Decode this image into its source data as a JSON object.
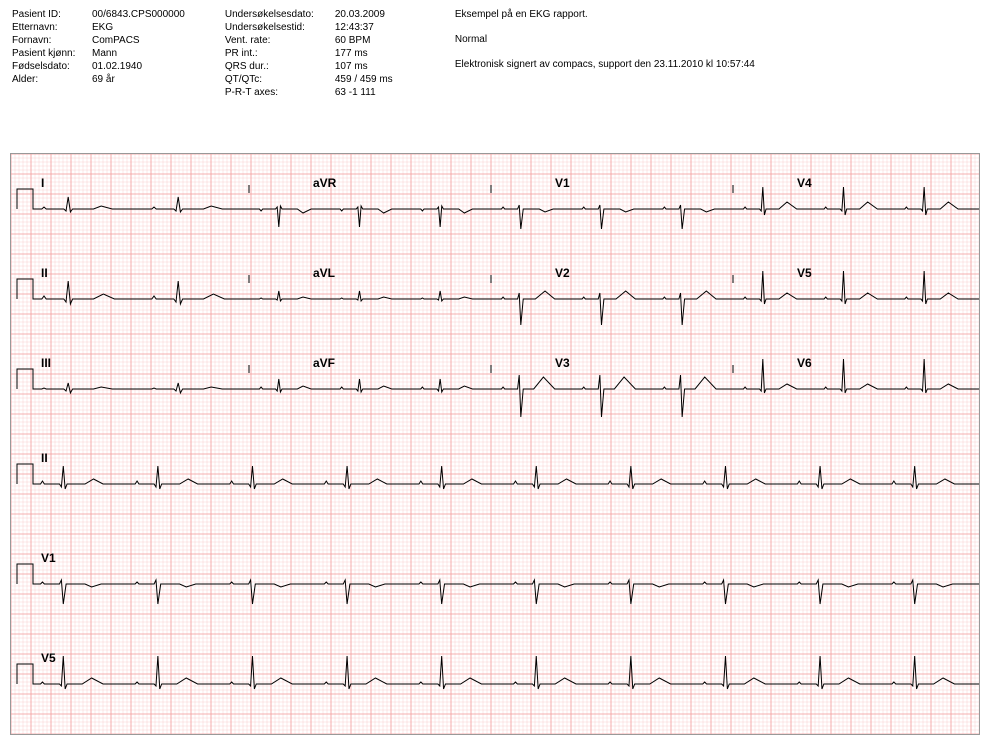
{
  "header": {
    "col1": {
      "labels": [
        "Pasient ID:",
        "Etternavn:",
        "Fornavn:",
        "Pasient kjønn:",
        "Fødselsdato:",
        "Alder:"
      ],
      "values": [
        "00/6843.CPS000000",
        "EKG",
        "ComPACS",
        "Mann",
        "01.02.1940",
        "69 år"
      ]
    },
    "col2": {
      "labels": [
        "Undersøkelsesdato:",
        "Undersøkelsestid:",
        "Vent. rate:",
        "PR int.:",
        "QRS dur.:",
        "QT/QTc:",
        "P-R-T axes:"
      ],
      "values": [
        "20.03.2009",
        "12:43:37",
        "60 BPM",
        "177 ms",
        "107 ms",
        "459 / 459 ms",
        "63 -1 111"
      ]
    },
    "notes": [
      "Eksempel på en EKG rapport.",
      "Normal",
      "Elektronisk signert av compacs, support den 23.11.2010 kl 10:57:44"
    ]
  },
  "leads": {
    "row1": [
      "I",
      "aVR",
      "V1",
      "V4"
    ],
    "row2": [
      "II",
      "aVL",
      "V2",
      "V5"
    ],
    "row3": [
      "III",
      "aVF",
      "V3",
      "V6"
    ],
    "rhythm": [
      "II",
      "V1",
      "V5"
    ]
  },
  "chart_data": {
    "type": "line",
    "title": "12-lead EKG",
    "paper_speed_mm_s": 25,
    "gain_mm_mV": 10,
    "duration_s": 10,
    "heart_rate_bpm": 60,
    "pr_ms": 177,
    "qrs_ms": 107,
    "qt_ms": 459,
    "qtc_ms": 459,
    "axes_deg": {
      "P": 63,
      "R": -1,
      "T": 111
    },
    "series": [
      {
        "name": "I",
        "morphology": "small P, small R, flat T",
        "polarity": "+"
      },
      {
        "name": "II",
        "morphology": "P, upright QRS, upright T",
        "polarity": "+"
      },
      {
        "name": "III",
        "morphology": "low amplitude, multiphasic",
        "polarity": "+/-"
      },
      {
        "name": "aVR",
        "morphology": "inverted QRS and T",
        "polarity": "-"
      },
      {
        "name": "aVL",
        "morphology": "small upright",
        "polarity": "+"
      },
      {
        "name": "aVF",
        "morphology": "low amplitude upright",
        "polarity": "+"
      },
      {
        "name": "V1",
        "morphology": "rS with deep S, inverted/biphasic T",
        "polarity": "-"
      },
      {
        "name": "V2",
        "morphology": "rS deep S, upright T",
        "polarity": "-"
      },
      {
        "name": "V3",
        "morphology": "RS transition, tall T",
        "polarity": "+/-"
      },
      {
        "name": "V4",
        "morphology": "qRs upright T",
        "polarity": "+"
      },
      {
        "name": "V5",
        "morphology": "tall R upright T",
        "polarity": "+"
      },
      {
        "name": "V6",
        "morphology": "tall R upright T",
        "polarity": "+"
      }
    ]
  }
}
